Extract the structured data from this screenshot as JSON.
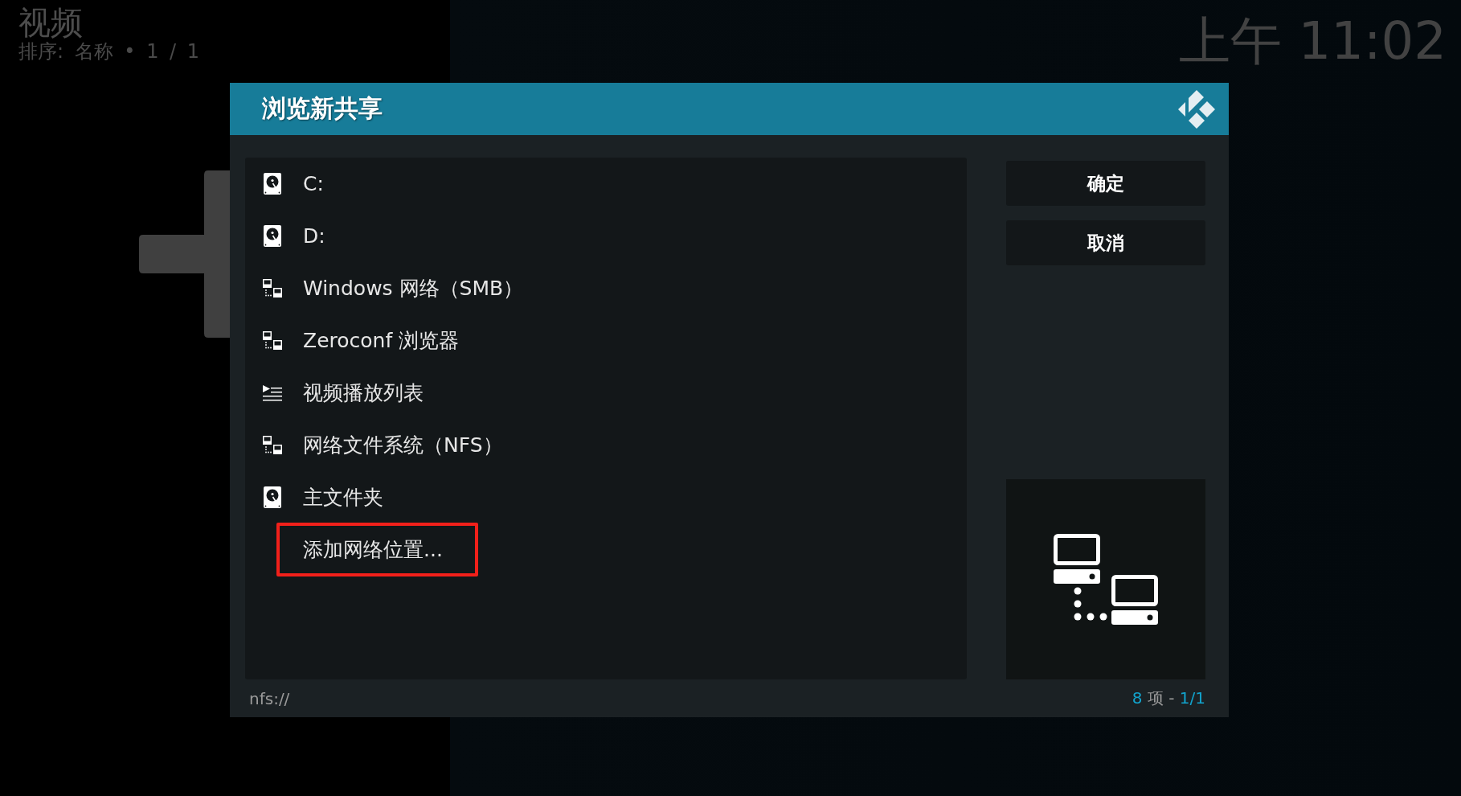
{
  "header": {
    "title": "视频",
    "subtitle": "排序: 名称 • 1 / 1"
  },
  "clock": "上午 11:02",
  "dialog": {
    "title": "浏览新共享",
    "items": [
      {
        "label": "C:",
        "kind": "drive",
        "highlighted": false
      },
      {
        "label": "D:",
        "kind": "drive",
        "highlighted": false
      },
      {
        "label": "Windows 网络（SMB）",
        "kind": "network",
        "highlighted": false
      },
      {
        "label": "Zeroconf 浏览器",
        "kind": "network",
        "highlighted": false
      },
      {
        "label": "视频播放列表",
        "kind": "playlist",
        "highlighted": false
      },
      {
        "label": "网络文件系统（NFS）",
        "kind": "network",
        "highlighted": false
      },
      {
        "label": "主文件夹",
        "kind": "drive",
        "highlighted": false
      },
      {
        "label": "添加网络位置...",
        "kind": "action",
        "highlighted": true
      }
    ],
    "buttons": [
      "确定",
      "取消"
    ],
    "footer": {
      "path": "nfs://",
      "item_count": "8",
      "count_unit": "项",
      "separator": "-",
      "page": "1/1"
    }
  }
}
